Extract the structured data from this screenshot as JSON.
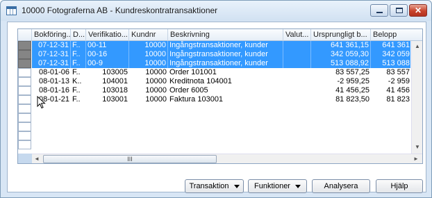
{
  "window": {
    "title": "10000 Fotograferna AB - Kundreskontratransaktioner",
    "controls": {
      "min": "minimize",
      "max": "maximize",
      "close": "✕"
    }
  },
  "table": {
    "columns": [
      "Bokföring...",
      "D...",
      "Verifikatio...",
      "Kundnr",
      "Beskrivning",
      "Valut...",
      "Ursprungligt b...",
      "Belopp"
    ],
    "rows": [
      {
        "date": "07-12-31",
        "d": "F..",
        "ver": "00-11",
        "kundnr": "10000",
        "desc": "Ingångstransaktioner, kunder",
        "cur": "",
        "orig": "641 361,15",
        "amount": "641 361",
        "selected": true
      },
      {
        "date": "07-12-31",
        "d": "F..",
        "ver": "00-16",
        "kundnr": "10000",
        "desc": "Ingångstransaktioner, kunder",
        "cur": "",
        "orig": "342 059,30",
        "amount": "342 059",
        "selected": true
      },
      {
        "date": "07-12-31",
        "d": "F..",
        "ver": "00-9",
        "kundnr": "10000",
        "desc": "Ingångstransaktioner, kunder",
        "cur": "",
        "orig": "513 088,92",
        "amount": "513 088",
        "selected": true
      },
      {
        "date": "08-01-06",
        "d": "F..",
        "ver": "103005",
        "kundnr": "10000",
        "desc": "Order 101001",
        "cur": "",
        "orig": "83 557,25",
        "amount": "83 557",
        "selected": false
      },
      {
        "date": "08-01-13",
        "d": "K..",
        "ver": "104001",
        "kundnr": "10000",
        "desc": "Kreditnota 104001",
        "cur": "",
        "orig": "-2 959,25",
        "amount": "-2 959",
        "selected": false
      },
      {
        "date": "08-01-16",
        "d": "F..",
        "ver": "103018",
        "kundnr": "10000",
        "desc": "Order 6005",
        "cur": "",
        "orig": "41 456,25",
        "amount": "41 456",
        "selected": false
      },
      {
        "date": "08-01-21",
        "d": "F..",
        "ver": "103001",
        "kundnr": "10000",
        "desc": "Faktura 103001",
        "cur": "",
        "orig": "81 823,50",
        "amount": "81 823",
        "selected": false
      }
    ]
  },
  "buttons": {
    "transaktion": "Transaktion",
    "funktioner": "Funktioner",
    "analysera": "Analysera",
    "hjalp": "Hjälp"
  },
  "scroll": {
    "thumb_glyph": "III",
    "up": "▲",
    "down": "▼",
    "left": "◄",
    "right": "►"
  },
  "colors": {
    "selection": "#3399ff",
    "row_header_selected": "#858585"
  }
}
